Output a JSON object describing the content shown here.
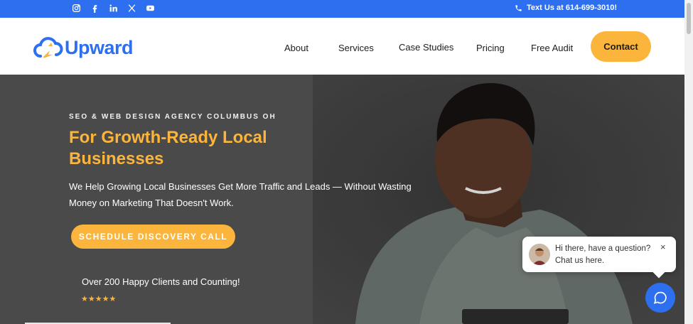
{
  "topbar": {
    "social": [
      "instagram-icon",
      "facebook-icon",
      "linkedin-icon",
      "x-icon",
      "youtube-icon"
    ],
    "phone": "Text Us at 614-699-3010!"
  },
  "header": {
    "logo_text": "Upward",
    "nav": [
      "About",
      "Services",
      "Case Studies",
      "Pricing",
      "Free Audit"
    ],
    "contact_label": "Contact"
  },
  "hero": {
    "eyebrow": "SEO & WEB DESIGN AGENCY COLUMBUS OH",
    "title": "For Growth-Ready Local Businesses",
    "subtitle": "We Help Growing Local Businesses Get More Traffic and Leads — Without Wasting Money on Marketing That Doesn't Work.",
    "cta_label": "SCHEDULE DISCOVERY CALL",
    "clients_text": "Over 200 Happy Clients and Counting!",
    "stars": "★★★★★",
    "rating": 5
  },
  "chat": {
    "message": "Hi there, have a question? Chat us here.",
    "close": "×"
  },
  "colors": {
    "brand_blue": "#2e6ff0",
    "accent_yellow": "#fbb53c",
    "hero_bg": "#4a4a4a"
  }
}
